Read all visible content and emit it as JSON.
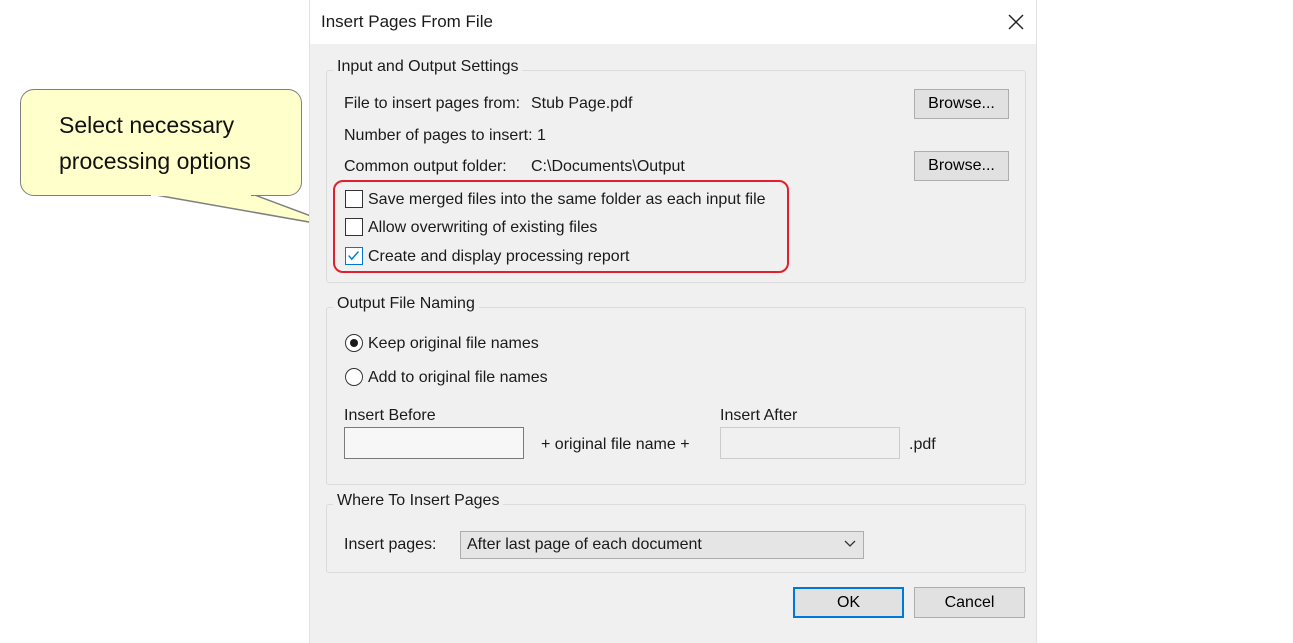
{
  "dialog": {
    "title": "Insert Pages From File"
  },
  "input_output": {
    "group_label": "Input and Output Settings",
    "file_label": "File to insert pages from:",
    "file_value": "Stub Page.pdf",
    "browse_label": "Browse...",
    "pages_label": "Number of pages to insert: 1",
    "output_label": "Common output folder:",
    "output_value": "C:\\Documents\\Output",
    "browse2_label": "Browse...",
    "options": [
      {
        "label": "Save merged files into the same folder as each input file",
        "checked": false
      },
      {
        "label": "Allow overwriting of existing files",
        "checked": false
      },
      {
        "label": "Create and display processing report",
        "checked": true
      }
    ]
  },
  "naming": {
    "group_label": "Output File Naming",
    "keep_label": "Keep original file names",
    "keep_selected": true,
    "add_label": "Add to original file names",
    "add_selected": false,
    "before_label": "Insert Before",
    "middle_label": "+ original file name +",
    "after_label": "Insert After",
    "ext_label": ".pdf"
  },
  "where": {
    "group_label": "Where To Insert Pages",
    "insert_label": "Insert pages:",
    "insert_value": "After last page of each document"
  },
  "footer": {
    "ok_label": "OK",
    "cancel_label": "Cancel"
  },
  "callout": {
    "text": "Select necessary processing options"
  },
  "colors": {
    "accent": "#0078d7",
    "highlight": "#e0202c",
    "callout_fill": "#ffffcc"
  }
}
